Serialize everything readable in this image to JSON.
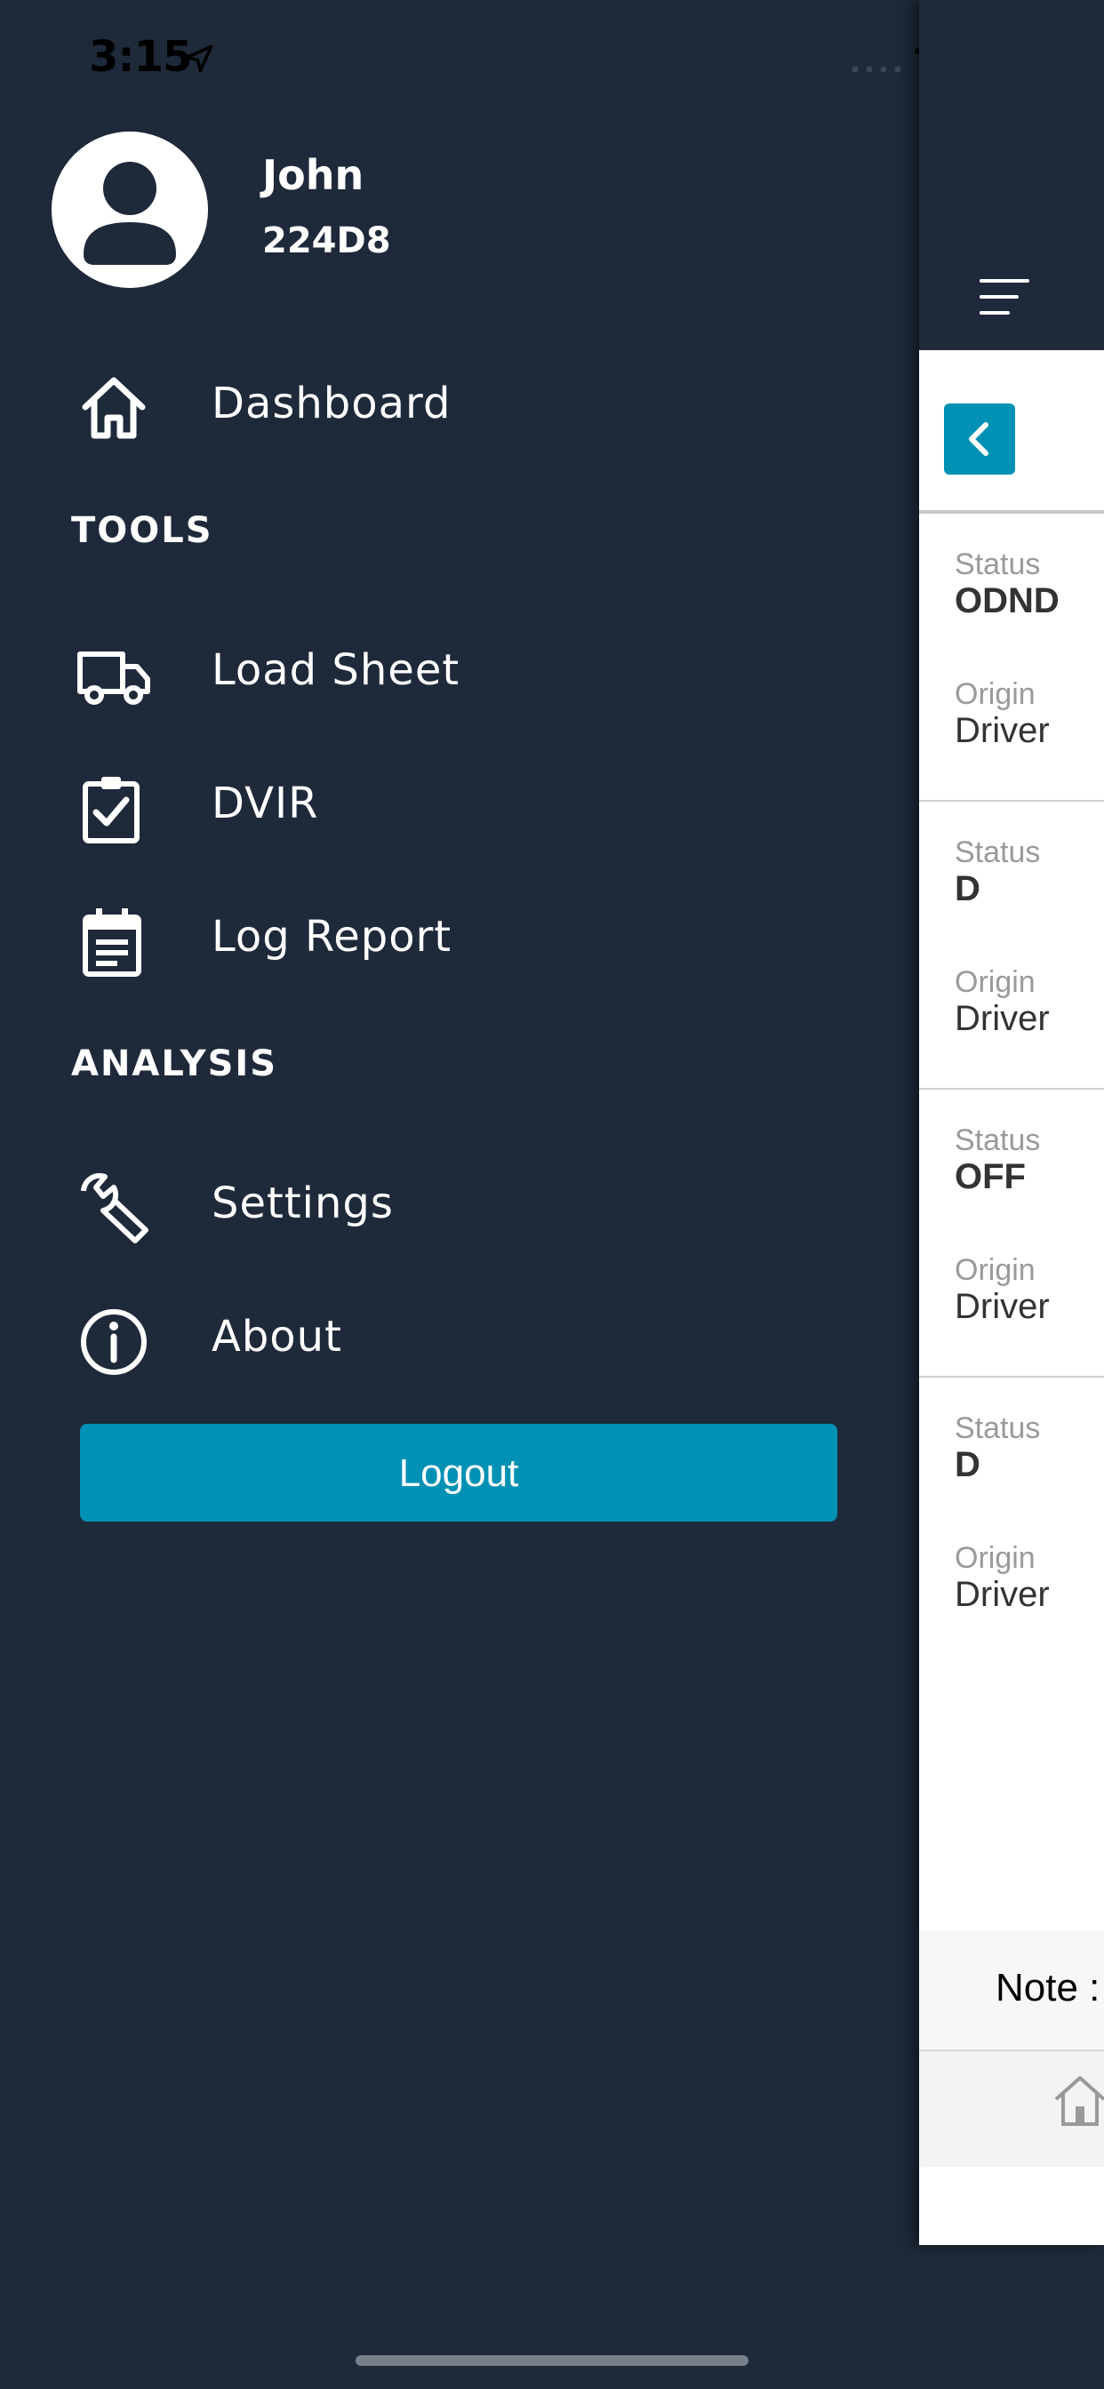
{
  "status_bar": {
    "time": "3:15"
  },
  "profile": {
    "name": "John",
    "id": "224D8"
  },
  "menu": {
    "dashboard": "Dashboard",
    "tools_header": "TOOLS",
    "tools": [
      {
        "label": "Load Sheet",
        "icon": "truck-icon"
      },
      {
        "label": "DVIR",
        "icon": "clipboard-check-icon"
      },
      {
        "label": "Log Report",
        "icon": "calendar-list-icon"
      }
    ],
    "analysis_header": "ANALYSIS",
    "analysis": [
      {
        "label": "Settings",
        "icon": "wrench-icon"
      },
      {
        "label": "About",
        "icon": "info-icon"
      }
    ],
    "logout_label": "Logout"
  },
  "panel": {
    "entries": [
      {
        "status_label": "Status",
        "status": "ODND",
        "origin_label": "Origin",
        "origin": "Driver"
      },
      {
        "status_label": "Status",
        "status": "D",
        "origin_label": "Origin",
        "origin": "Driver"
      },
      {
        "status_label": "Status",
        "status": "OFF",
        "origin_label": "Origin",
        "origin": "Driver"
      },
      {
        "status_label": "Status",
        "status": "D",
        "origin_label": "Origin",
        "origin": "Driver"
      }
    ],
    "note": "Note :"
  },
  "colors": {
    "background": "#1e2a3a",
    "accent": "#0191b4",
    "text": "#ffffff"
  }
}
